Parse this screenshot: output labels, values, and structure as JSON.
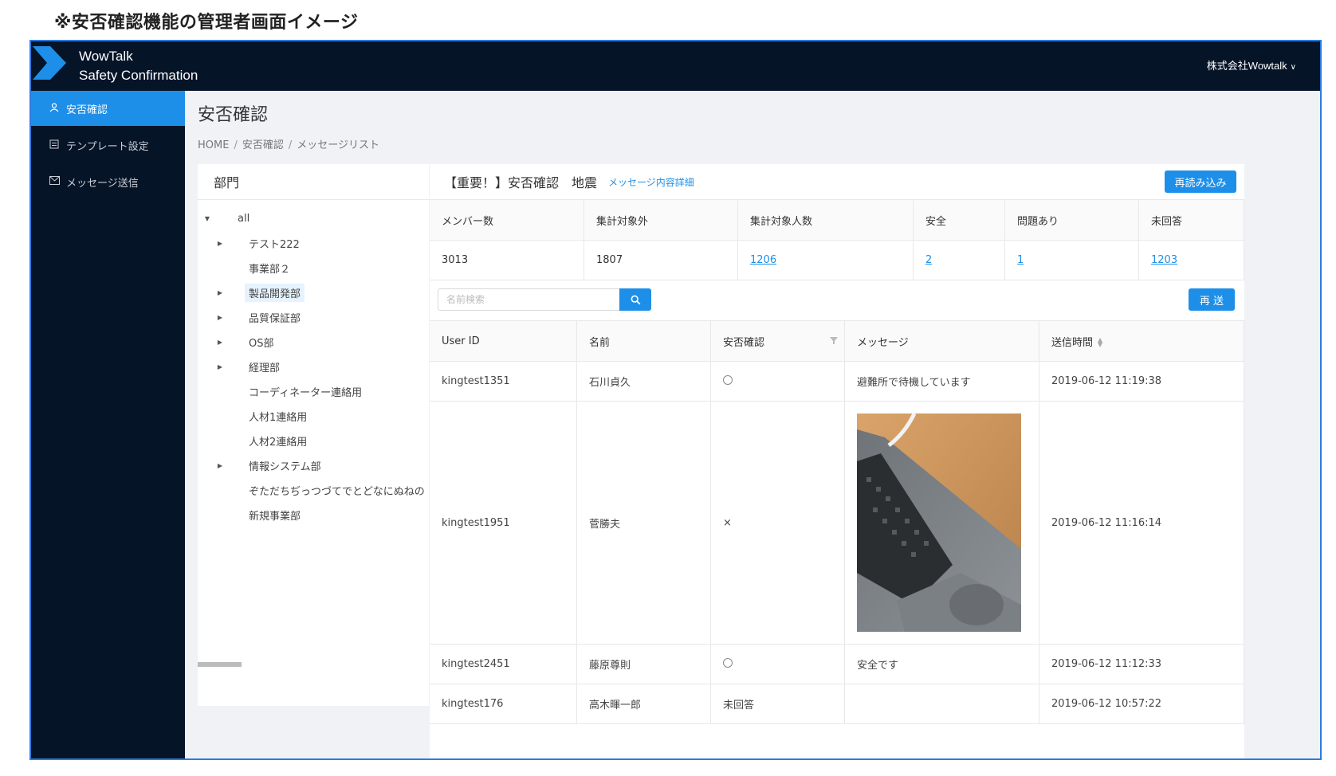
{
  "caption": "※安否確認機能の管理者画面イメージ",
  "header": {
    "brand_line1": "WowTalk",
    "brand_line2": "Safety Confirmation",
    "company": "株式会社Wowtalk",
    "logo_color": "#1e8fe8"
  },
  "sidebar": {
    "items": [
      {
        "label": "安否確認",
        "icon": "person-icon",
        "active": true
      },
      {
        "label": "テンプレート設定",
        "icon": "template-icon",
        "active": false
      },
      {
        "label": "メッセージ送信",
        "icon": "mail-icon",
        "active": false
      }
    ]
  },
  "page": {
    "title": "安否確認",
    "breadcrumb": [
      "HOME",
      "安否確認",
      "メッセージリスト"
    ]
  },
  "departments": {
    "title": "部門",
    "nodes": [
      {
        "label": "all",
        "level": 0,
        "arrow": "down"
      },
      {
        "label": "テスト222",
        "level": 1,
        "arrow": "right"
      },
      {
        "label": "事業部２",
        "level": 1,
        "arrow": ""
      },
      {
        "label": "製品開発部",
        "level": 1,
        "arrow": "right",
        "selected": true
      },
      {
        "label": "品質保証部",
        "level": 1,
        "arrow": "right"
      },
      {
        "label": "OS部",
        "level": 1,
        "arrow": "right"
      },
      {
        "label": "経理部",
        "level": 1,
        "arrow": "right"
      },
      {
        "label": "コーディネーター連絡用",
        "level": 1,
        "arrow": ""
      },
      {
        "label": "人材1連絡用",
        "level": 1,
        "arrow": ""
      },
      {
        "label": "人材2連絡用",
        "level": 1,
        "arrow": ""
      },
      {
        "label": "情報システム部",
        "level": 1,
        "arrow": "right"
      },
      {
        "label": "ぞただちぢっつづてでとどなにぬねの",
        "level": 1,
        "arrow": ""
      },
      {
        "label": "新規事業部",
        "level": 1,
        "arrow": ""
      }
    ]
  },
  "message": {
    "title": "【重要！】安否確認　地震",
    "detail_link": "メッセージ内容詳細",
    "reload_label": "再読み込み"
  },
  "stats": {
    "headers": [
      "メンバー数",
      "集計対象外",
      "集計対象人数",
      "安全",
      "問題あり",
      "未回答"
    ],
    "values": [
      "3013",
      "1807",
      "1206",
      "2",
      "1",
      "1203"
    ]
  },
  "search": {
    "placeholder": "名前検索",
    "value": ""
  },
  "resend_label": "再 送",
  "users": {
    "headers": [
      "User ID",
      "名前",
      "安否確認",
      "メッセージ",
      "送信時間"
    ],
    "rows": [
      {
        "user_id": "kingtest1351",
        "name": "石川貞久",
        "status": "○",
        "message": "避難所で待機しています",
        "time": "2019-06-12 11:19:38"
      },
      {
        "user_id": "kingtest1951",
        "name": "菅勝夫",
        "status": "×",
        "message": "",
        "time": "2019-06-12 11:16:14"
      },
      {
        "user_id": "kingtest2451",
        "name": "藤原尊則",
        "status": "○",
        "message": "安全です",
        "time": "2019-06-12 11:12:33"
      },
      {
        "user_id": "kingtest176",
        "name": "高木暉一郎",
        "status": "未回答",
        "message": "",
        "time": "2019-06-12 10:57:22"
      }
    ]
  }
}
